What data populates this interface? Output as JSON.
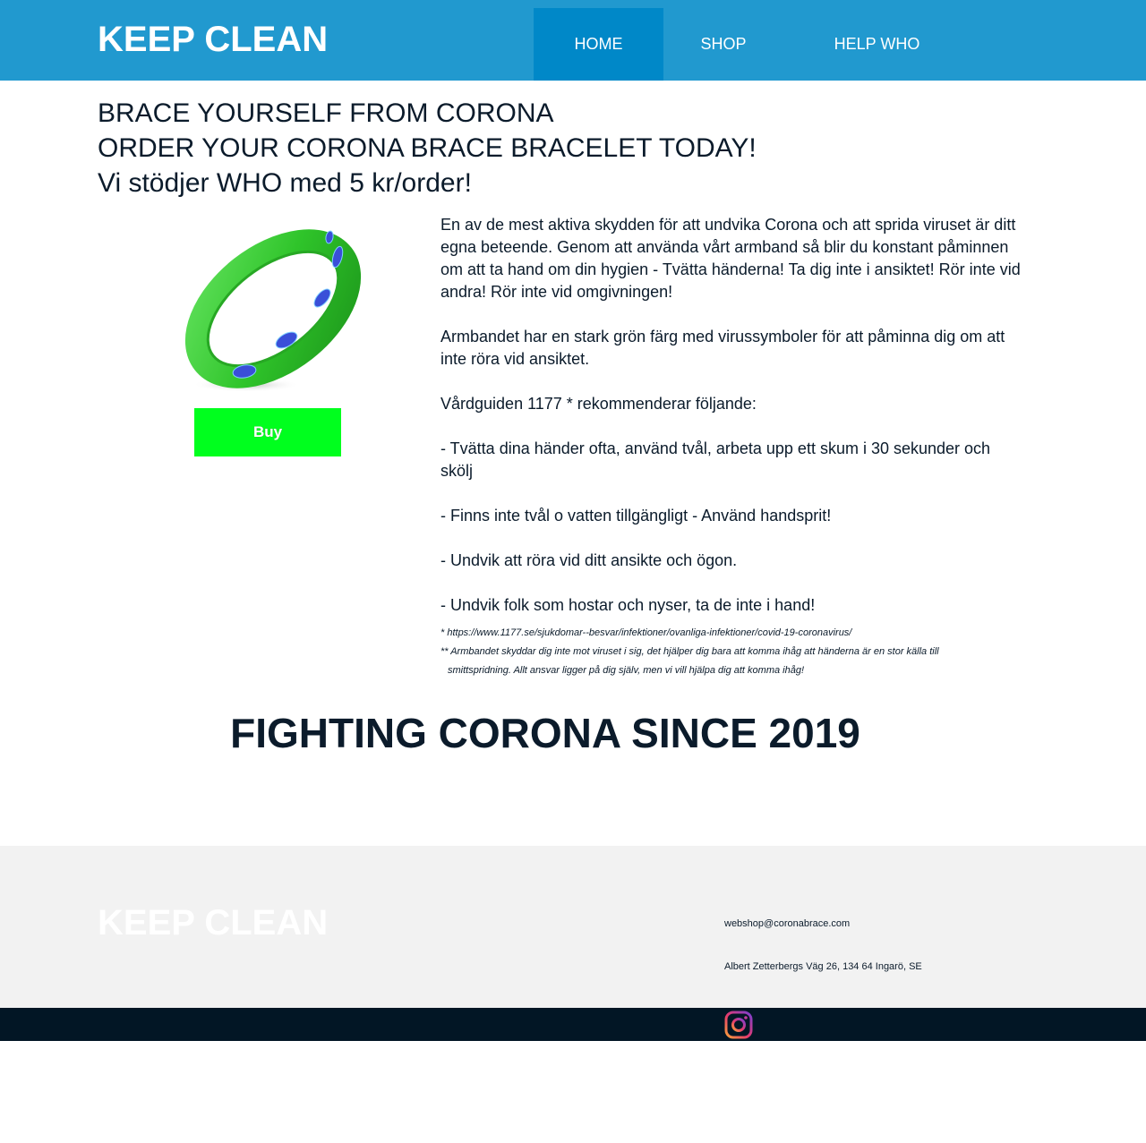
{
  "header": {
    "logo": "KEEP CLEAN",
    "nav": [
      {
        "label": "HOME",
        "active": true
      },
      {
        "label": "SHOP",
        "active": false
      },
      {
        "label": "HELP WHO",
        "active": false
      }
    ]
  },
  "main": {
    "headings": [
      "BRACE YOURSELF FROM CORONA",
      "ORDER YOUR CORONA BRACE BRACELET TODAY!",
      "Vi stödjer WHO med 5 kr/order!"
    ],
    "buy_label": "Buy",
    "paragraphs": [
      "En av de mest aktiva skydden för att undvika Corona och att sprida viruset är ditt egna beteende. Genom att använda vårt armband så blir du konstant påminnen om att ta hand om din hygien - Tvätta händerna! Ta dig inte i ansiktet! Rör inte vid andra! Rör inte vid omgivningen!",
      "Armbandet har en stark grön färg med virussymboler för att påminna dig om att inte röra vid ansiktet.",
      "Vårdguiden 1177 * rekommenderar följande:",
      "- Tvätta dina händer ofta, använd tvål, arbeta upp ett skum i 30 sekunder och skölj",
      "- Finns inte tvål o vatten tillgängligt - Använd handsprit!",
      "- Undvik att röra vid ditt ansikte och ögon.",
      "- Undvik folk som hostar och nyser, ta de inte i hand!"
    ],
    "footnotes": {
      "note1": "* https://www.1177.se/sjukdomar--besvar/infektioner/ovanliga-infektioner/covid-19-coronavirus/",
      "note2_line1": "** Armbandet skyddar dig inte mot viruset i sig, det hjälper dig bara att komma ihåg att händerna är en stor källa till",
      "note2_line2": "smittspridning. Allt ansvar ligger på dig själv, men vi vill hjälpa dig att komma ihåg!"
    },
    "tagline": "FIGHTING CORONA SINCE 2019"
  },
  "footer": {
    "logo": "KEEP CLEAN",
    "email": "webshop@coronabrace.com",
    "address": "Albert Zetterbergs Väg 26, 134 64 Ingarö, SE",
    "social_icon": "instagram-icon"
  },
  "colors": {
    "header_bg": "#2199cf",
    "nav_active_bg": "#0088c8",
    "buy_button": "#00ff1e",
    "footer_bg": "#f2f2f2",
    "bottom_bar": "#021625",
    "text": "#0b1b2b"
  }
}
